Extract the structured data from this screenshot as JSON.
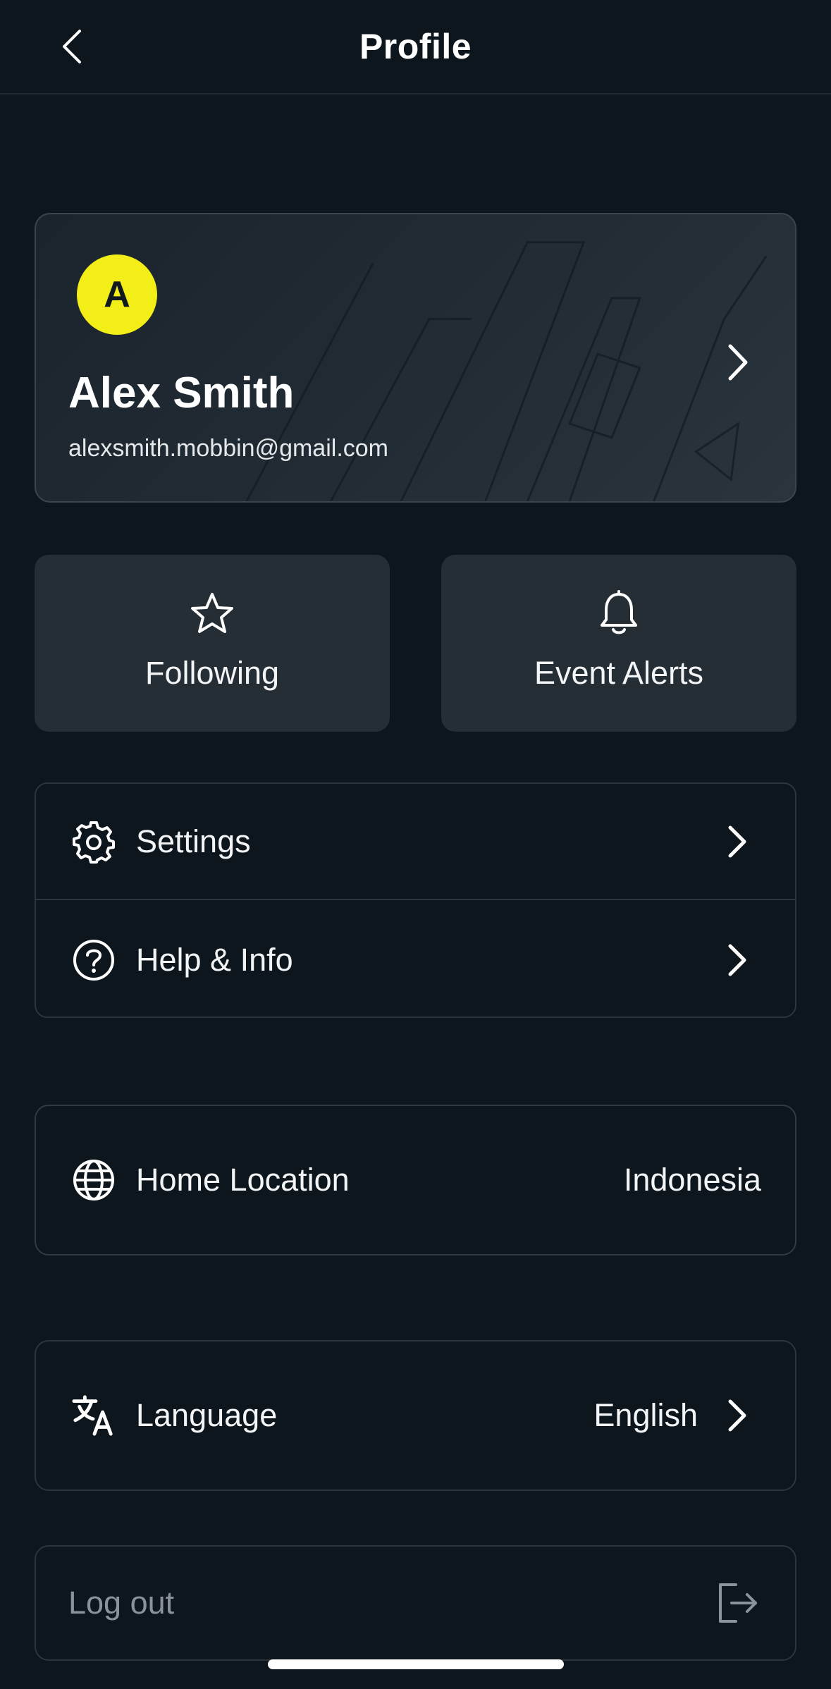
{
  "header": {
    "title": "Profile",
    "back_icon": "chevron-left-icon"
  },
  "profile": {
    "avatar_initial": "A",
    "avatar_color": "#f3ee18",
    "name": "Alex Smith",
    "email": "alexsmith.mobbin@gmail.com"
  },
  "tiles": [
    {
      "label": "Following",
      "icon": "star-icon"
    },
    {
      "label": "Event Alerts",
      "icon": "bell-icon"
    }
  ],
  "menu": [
    {
      "label": "Settings",
      "icon": "gear-icon"
    },
    {
      "label": "Help & Info",
      "icon": "help-circle-icon"
    }
  ],
  "home_location": {
    "label": "Home Location",
    "value": "Indonesia",
    "icon": "globe-icon"
  },
  "language": {
    "label": "Language",
    "value": "English",
    "icon": "translate-icon"
  },
  "logout": {
    "label": "Log out",
    "icon": "logout-icon"
  },
  "colors": {
    "background": "#0e161d",
    "tile": "#252d35",
    "accent_avatar": "#f3ee18",
    "muted_text": "#8b939a"
  }
}
